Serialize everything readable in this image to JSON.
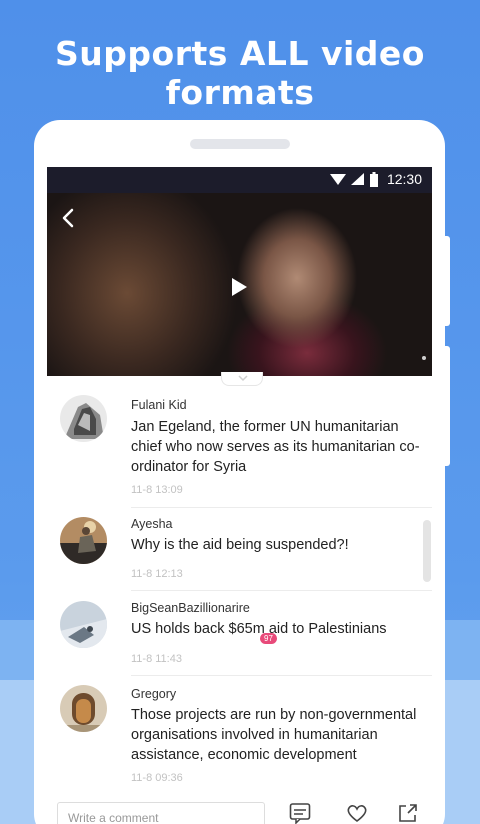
{
  "headline": "Supports ALL video formats",
  "status_bar": {
    "time": "12:30"
  },
  "comments": [
    {
      "user": "Fulani Kid",
      "lines": [
        "Jan Egeland, the former UN humanitarian",
        "chief who now serves as its humanitarian co-",
        "ordinator for Syria"
      ],
      "time": "11-8 13:09"
    },
    {
      "user": "Ayesha",
      "lines": [
        "Why is the aid being suspended?!"
      ],
      "time": "11-8 12:13"
    },
    {
      "user": "BigSeanBazillionarire",
      "lines": [
        "US holds back $65m aid to Palestinians"
      ],
      "time": "11-8 11:43"
    },
    {
      "user": "Gregory",
      "lines": [
        "Those projects are run by non-governmental",
        "organisations involved in humanitarian",
        "assistance, economic development"
      ],
      "time": "11-8 09:36"
    }
  ],
  "bottom_bar": {
    "placeholder": "Write a comment",
    "comment_count": "97"
  },
  "colors": {
    "accent_blue": "#4f90ea",
    "badge_pink": "#e84a7a"
  }
}
